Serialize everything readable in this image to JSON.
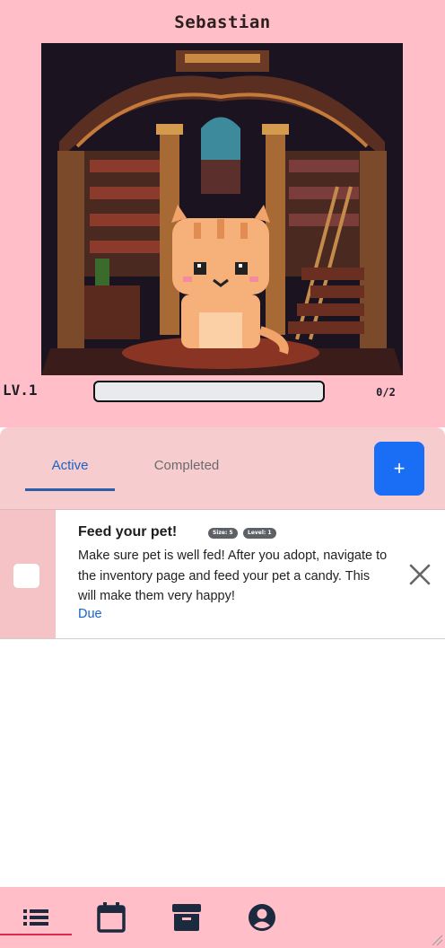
{
  "pet": {
    "name": "Sebastian",
    "level_label": "LV.1",
    "xp_count": "0/2",
    "xp_progress": 0.0
  },
  "tabs": {
    "active_label": "Active",
    "completed_label": "Completed",
    "add_label": "+"
  },
  "task": {
    "title": "Feed your pet!",
    "badge_size": "Size: 5",
    "badge_level": "Level: 1",
    "description": "Make sure pet is well fed! After you adopt, navigate to the inventory page and feed your pet a candy. This will make them very happy!",
    "due_label": "Due"
  },
  "nav": {
    "items": [
      {
        "icon": "list-icon"
      },
      {
        "icon": "calendar-icon"
      },
      {
        "icon": "archive-icon"
      },
      {
        "icon": "account-icon"
      }
    ]
  },
  "colors": {
    "header_bg": "#ffbec8",
    "accent": "#1a6ef5",
    "tab_active": "#1a63c6"
  }
}
